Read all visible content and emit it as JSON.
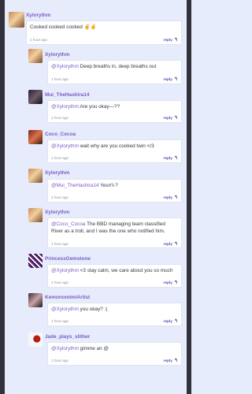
{
  "comments": [
    {
      "author": "Xylorythm",
      "mention": "",
      "text": "Cooked cooked cooked ✌️✌️",
      "time": "1 hour ago",
      "reply": "reply"
    },
    {
      "author": "Xylorythm",
      "mention": "@Xylorythm",
      "text": " Deep breaths in, deep breaths out",
      "time": "1 hour ago",
      "reply": "reply"
    },
    {
      "author": "Mui_TheHashira14",
      "mention": "@Xylorythm",
      "text": " Are you okay—??",
      "time": "1 hour ago",
      "reply": "reply"
    },
    {
      "author": "Coco_Cocoa",
      "mention": "@Xylorythm",
      "text": " wait why are you cooked twin </3",
      "time": "1 hour ago",
      "reply": "reply"
    },
    {
      "author": "Xylorythm",
      "mention": "@Mui_TheHashira14",
      "text": " Yesn't-?",
      "time": "1 hour ago",
      "reply": "reply"
    },
    {
      "author": "Xylorythm",
      "mention": "@Coco_Cocoa",
      "text": " The BBD managing team classified River as a troll, and I was the one who notified him.",
      "time": "1 hour ago",
      "reply": "reply"
    },
    {
      "author": "PrincessGemstone",
      "mention": "@Xylorythm",
      "text": " <3 stay calm, we care about you so much",
      "time": "1 hour ago",
      "reply": "reply"
    },
    {
      "author": "KemonomimiArtist",
      "mention": "@Xylorythm",
      "text": " you okay? :(",
      "time": "1 hour ago",
      "reply": "reply"
    },
    {
      "author": "Jade_plays_slither",
      "mention": "@Xylorythm",
      "text": " gimme an @",
      "time": "1 hour ago",
      "reply": "reply"
    }
  ],
  "icons": {
    "reply": "reply-arrow-icon"
  },
  "colors": {
    "username": "#7b5cc6",
    "background": "#e6ecfb",
    "reply": "#5a4db8"
  }
}
